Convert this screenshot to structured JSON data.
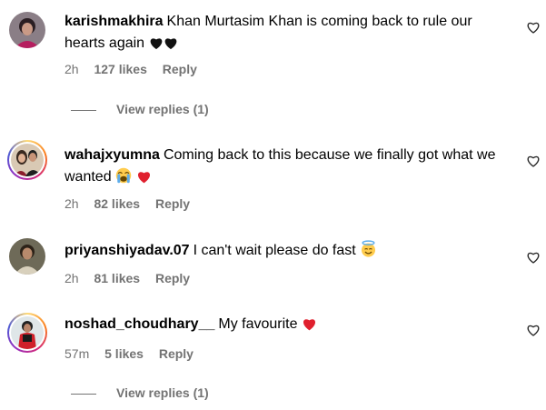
{
  "comments": [
    {
      "username": "karishmakhira",
      "text": "Khan Murtasim Khan is coming back to rule our hearts again",
      "emojis": [
        "black-heart-icon",
        "black-heart-icon"
      ],
      "time": "2h",
      "likes": "127 likes",
      "reply_label": "Reply",
      "view_replies": "View replies (1)"
    },
    {
      "username": "wahajxyumna",
      "text": "Coming back to this because we finally got what we wanted",
      "emojis": [
        "crying-face-icon",
        "red-heart-icon"
      ],
      "time": "2h",
      "likes": "82 likes",
      "reply_label": "Reply"
    },
    {
      "username": "priyanshiyadav.07",
      "text": "I can't wait please do fast",
      "emojis": [
        "halo-face-icon"
      ],
      "time": "2h",
      "likes": "81 likes",
      "reply_label": "Reply"
    },
    {
      "username": "noshad_choudhary__",
      "text": "My favourite",
      "emojis": [
        "red-heart-icon"
      ],
      "time": "57m",
      "likes": "5 likes",
      "reply_label": "Reply",
      "view_replies": "View replies (1)"
    }
  ],
  "colors": {
    "secondary_text": "#737373",
    "heart_red": "#ff3040",
    "primary_text": "#000000"
  }
}
